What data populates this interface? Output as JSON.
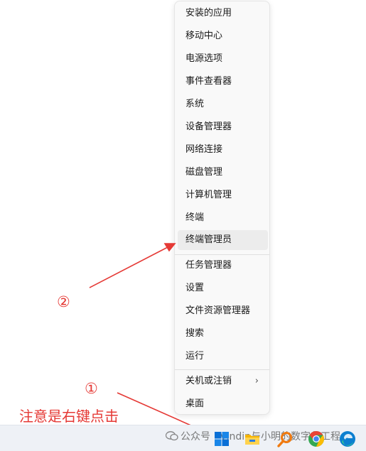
{
  "context_menu": {
    "items": [
      {
        "label": "安装的应用"
      },
      {
        "label": "移动中心"
      },
      {
        "label": "电源选项"
      },
      {
        "label": "事件查看器"
      },
      {
        "label": "系统"
      },
      {
        "label": "设备管理器"
      },
      {
        "label": "网络连接"
      },
      {
        "label": "磁盘管理"
      },
      {
        "label": "计算机管理"
      },
      {
        "label": "终端"
      },
      {
        "label": "终端管理员"
      },
      {
        "label": "任务管理器"
      },
      {
        "label": "设置"
      },
      {
        "label": "文件资源管理器"
      },
      {
        "label": "搜索"
      },
      {
        "label": "运行"
      },
      {
        "label": "关机或注销",
        "chevron": "›"
      },
      {
        "label": "桌面"
      }
    ],
    "highlighted_item": "终端管理员"
  },
  "annotations": {
    "step1_marker": "①",
    "step2_marker": "②",
    "note": "注意是右键点击",
    "color": "#e53935"
  },
  "taskbar": {
    "watermark": "公众号 · Vindin与小明的数字化工程",
    "icons": [
      "start-icon",
      "file-explorer-icon",
      "search-icon",
      "chrome-icon",
      "edge-icon"
    ]
  }
}
